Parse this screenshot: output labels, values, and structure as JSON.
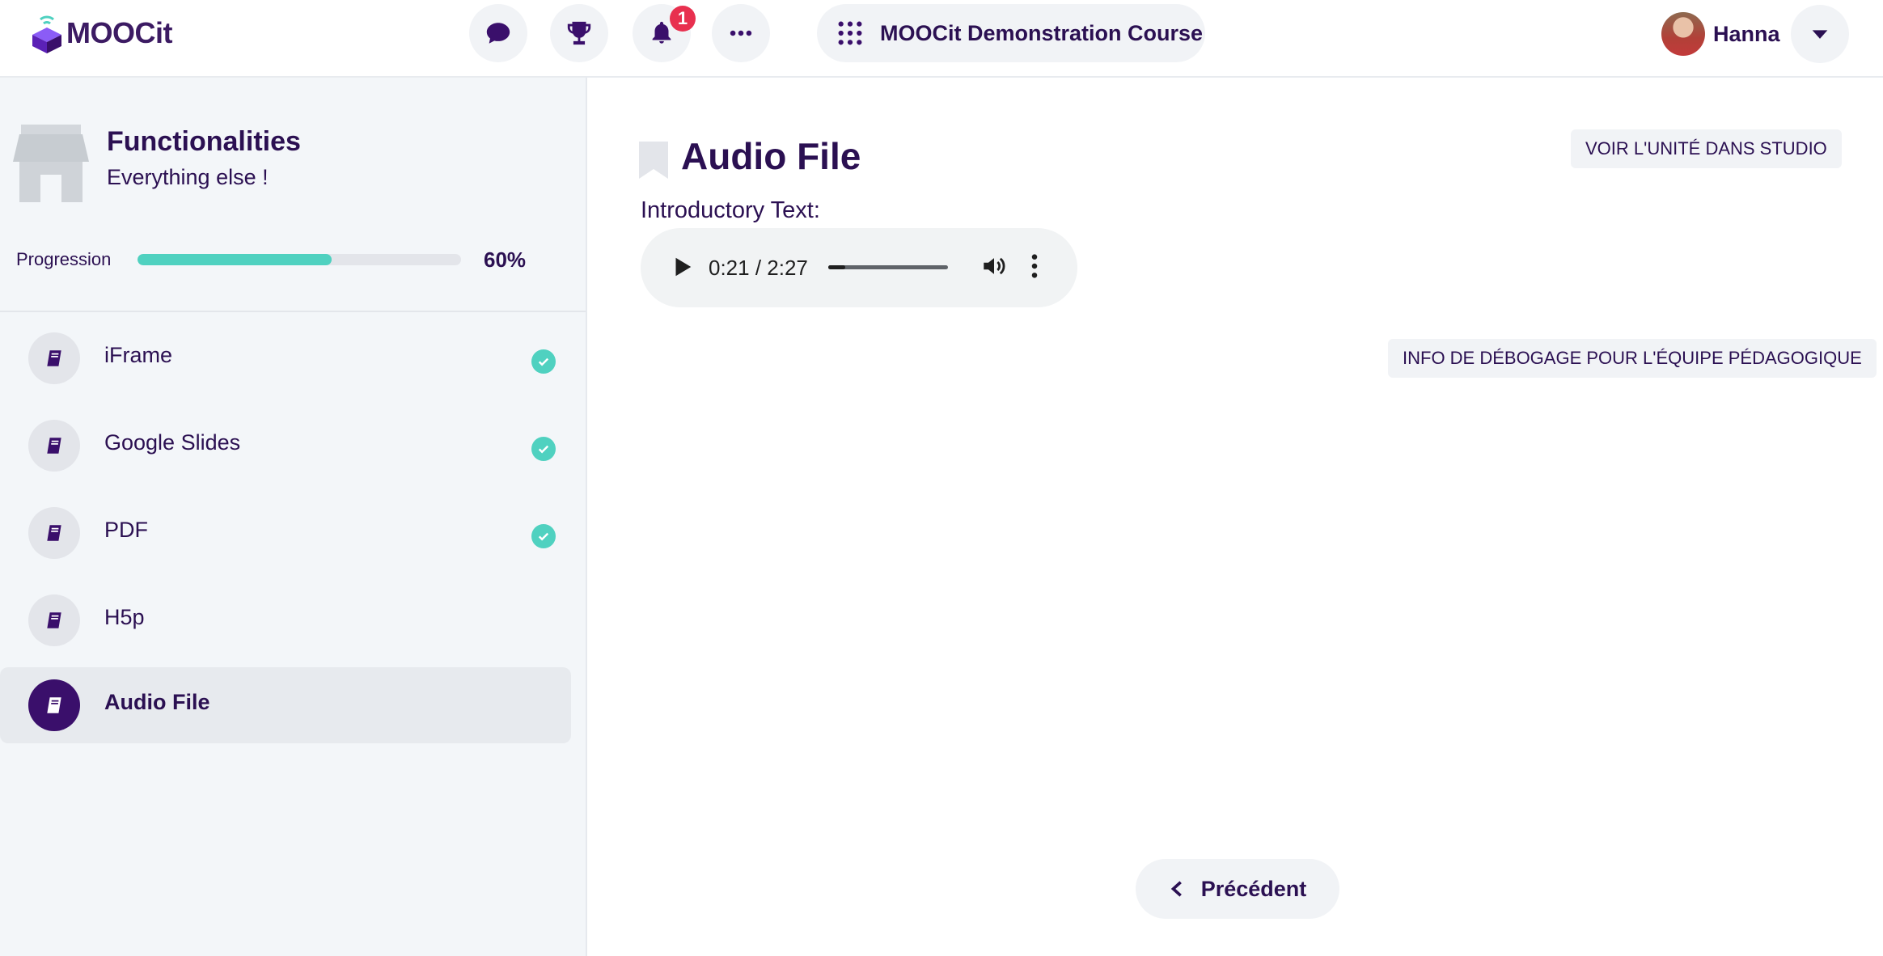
{
  "brand": {
    "name": "MOOCit"
  },
  "header": {
    "notifications_count": "1",
    "course_name": "MOOCit Demonstration Course",
    "user_name": "Hanna",
    "icons": [
      "chat-icon",
      "trophy-icon",
      "bell-icon",
      "more-icon",
      "apps-grid-icon",
      "chevron-down-icon"
    ]
  },
  "sidebar": {
    "section_title": "Functionalities",
    "section_subtitle": "Everything else !",
    "progress_label": "Progression",
    "progress_value": 0.6,
    "progress_text": "60%",
    "items": [
      {
        "label": "iFrame",
        "completed": true,
        "active": false
      },
      {
        "label": "Google Slides",
        "completed": true,
        "active": false
      },
      {
        "label": "PDF",
        "completed": true,
        "active": false
      },
      {
        "label": "H5p",
        "completed": false,
        "active": false
      },
      {
        "label": "Audio File",
        "completed": false,
        "active": true
      }
    ]
  },
  "main": {
    "unit_title": "Audio File",
    "studio_button": "VOIR L'UNITÉ DANS STUDIO",
    "intro_text": "Introductory Text:",
    "audio": {
      "time_display": "0:21 / 2:27",
      "progress_value": 0.143
    },
    "debug_button": "INFO DE DÉBOGAGE POUR L'ÉQUIPE PÉDAGOGIQUE",
    "prev_button": "Précédent"
  },
  "colors": {
    "brand_purple": "#3a0f6b",
    "text": "#2b1052",
    "accent_teal": "#4fd1c0",
    "badge_red": "#e8304f",
    "sidebar_bg": "#f3f6f9"
  }
}
